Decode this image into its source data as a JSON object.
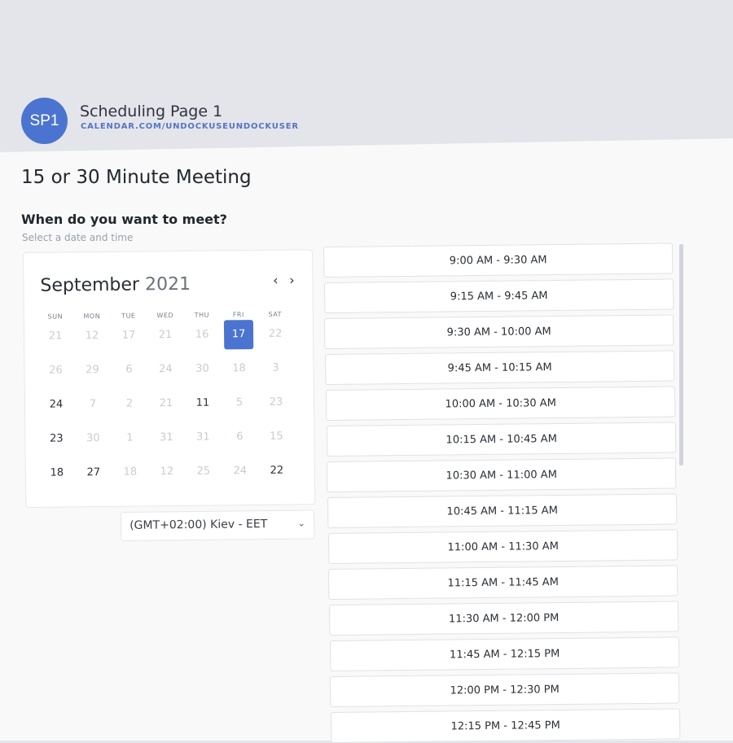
{
  "header": {
    "avatar_initials": "SP1",
    "title": "Scheduling Page 1",
    "url": "CALENDAR.COM/UNDOCKUSEUNDOCKUSER"
  },
  "meeting": {
    "title": "15 or 30 Minute Meeting",
    "question": "When do you want to meet?",
    "subtitle": "Select a date and time"
  },
  "calendar": {
    "month": "September",
    "year": "2021",
    "prev_icon": "chevron-left-icon",
    "next_icon": "chevron-right-icon",
    "weekdays": [
      "SUN",
      "MON",
      "TUE",
      "WED",
      "THU",
      "FRI",
      "SAT"
    ],
    "weeks": [
      [
        {
          "d": "21",
          "s": "muted"
        },
        {
          "d": "12",
          "s": "muted"
        },
        {
          "d": "17",
          "s": "muted"
        },
        {
          "d": "21",
          "s": "muted"
        },
        {
          "d": "16",
          "s": "muted"
        },
        {
          "d": "17",
          "s": "selected"
        },
        {
          "d": "22",
          "s": "muted"
        }
      ],
      [
        {
          "d": "26",
          "s": "muted"
        },
        {
          "d": "29",
          "s": "muted"
        },
        {
          "d": "6",
          "s": "muted"
        },
        {
          "d": "24",
          "s": "muted"
        },
        {
          "d": "30",
          "s": "muted"
        },
        {
          "d": "18",
          "s": "muted"
        },
        {
          "d": "3",
          "s": "muted"
        }
      ],
      [
        {
          "d": "24",
          "s": "active"
        },
        {
          "d": "7",
          "s": "muted"
        },
        {
          "d": "2",
          "s": "muted"
        },
        {
          "d": "21",
          "s": "muted"
        },
        {
          "d": "11",
          "s": "active"
        },
        {
          "d": "5",
          "s": "muted"
        },
        {
          "d": "23",
          "s": "muted"
        }
      ],
      [
        {
          "d": "23",
          "s": "active"
        },
        {
          "d": "30",
          "s": "muted"
        },
        {
          "d": "1",
          "s": "muted"
        },
        {
          "d": "31",
          "s": "muted"
        },
        {
          "d": "31",
          "s": "muted"
        },
        {
          "d": "6",
          "s": "muted"
        },
        {
          "d": "15",
          "s": "muted"
        }
      ],
      [
        {
          "d": "18",
          "s": "active"
        },
        {
          "d": "27",
          "s": "active"
        },
        {
          "d": "18",
          "s": "muted"
        },
        {
          "d": "12",
          "s": "muted"
        },
        {
          "d": "25",
          "s": "muted"
        },
        {
          "d": "24",
          "s": "muted"
        },
        {
          "d": "22",
          "s": "active"
        }
      ]
    ],
    "colors": {
      "selected_bg": "#4a74cf"
    }
  },
  "timezone": {
    "value": "(GMT+02:00) Kiev - EET",
    "icon": "chevron-down-icon"
  },
  "slots": [
    "9:00 AM - 9:30 AM",
    "9:15 AM - 9:45 AM",
    "9:30 AM - 10:00 AM",
    "9:45 AM - 10:15 AM",
    "10:00 AM - 10:30 AM",
    "10:15 AM - 10:45 AM",
    "10:30 AM - 11:00 AM",
    "10:45 AM - 11:15 AM",
    "11:00 AM - 11:30 AM",
    "11:15 AM - 11:45 AM",
    "11:30 AM - 12:00 PM",
    "11:45 AM - 12:15 PM",
    "12:00 PM - 12:30 PM",
    "12:15 PM - 12:45 PM"
  ]
}
